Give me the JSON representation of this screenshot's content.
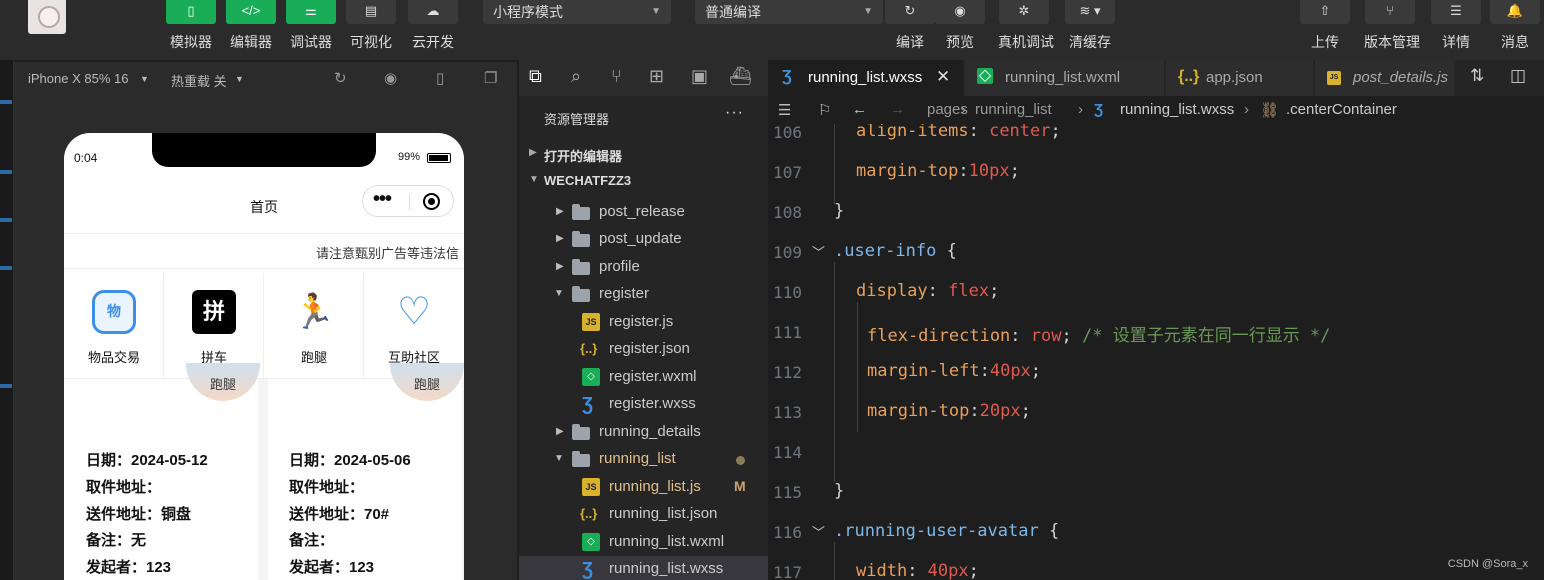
{
  "toolbar": {
    "left_buttons": [
      {
        "label": "模拟器",
        "icon": "phone-icon"
      },
      {
        "label": "编辑器",
        "icon": "code-icon"
      },
      {
        "label": "调试器",
        "icon": "sliders-icon"
      },
      {
        "label": "可视化",
        "icon": "layout-icon"
      },
      {
        "label": "云开发",
        "icon": "cloud-icon"
      }
    ],
    "mode_select": "小程序模式",
    "compile_select": "普通编译",
    "center_buttons": [
      {
        "label": "编译",
        "icon": "refresh-icon"
      },
      {
        "label": "预览",
        "icon": "eye-icon"
      },
      {
        "label": "真机调试",
        "icon": "bug-icon"
      },
      {
        "label": "清缓存",
        "icon": "layers-icon"
      }
    ],
    "right_buttons": [
      {
        "label": "上传",
        "icon": "upload-icon"
      },
      {
        "label": "版本管理",
        "icon": "branch-icon"
      },
      {
        "label": "详情",
        "icon": "menu-icon"
      },
      {
        "label": "消息",
        "icon": "bell-icon"
      }
    ]
  },
  "simulator": {
    "device": "iPhone X 85% 16",
    "hot_reload": "热重载 关",
    "status_time": "0:04",
    "battery": "99%",
    "nav_title": "首页",
    "notice": "请注意甄别广告等违法信",
    "categories": [
      {
        "label": "物品交易",
        "glyph": "物"
      },
      {
        "label": "拼车",
        "glyph": "拼"
      },
      {
        "label": "跑腿",
        "glyph": "🏃"
      },
      {
        "label": "互助社区",
        "glyph": "♡"
      }
    ],
    "cards": [
      {
        "tag": "跑腿",
        "date": "日期：2024-05-12",
        "pickup": "取件地址：",
        "delivery": "送件地址：铜盘",
        "note": "备注：无",
        "sender": "发起者：123"
      },
      {
        "tag": "跑腿",
        "date": "日期：2024-05-06",
        "pickup": "取件地址：",
        "delivery": "送件地址：70#",
        "note": "备注：",
        "sender": "发起者：123"
      }
    ]
  },
  "explorer": {
    "title": "资源管理器",
    "more": "···",
    "open_editors": "打开的编辑器",
    "project": "WECHATFZZ3",
    "items": [
      {
        "name": "post_release",
        "type": "folder"
      },
      {
        "name": "post_update",
        "type": "folder"
      },
      {
        "name": "profile",
        "type": "folder"
      },
      {
        "name": "register",
        "type": "folder-open"
      },
      {
        "name": "register.js",
        "type": "js"
      },
      {
        "name": "register.json",
        "type": "json"
      },
      {
        "name": "register.wxml",
        "type": "wxml"
      },
      {
        "name": "register.wxss",
        "type": "wxss"
      },
      {
        "name": "running_details",
        "type": "folder"
      },
      {
        "name": "running_list",
        "type": "folder-open"
      },
      {
        "name": "running_list.js",
        "type": "js",
        "badge": "M"
      },
      {
        "name": "running_list.json",
        "type": "json"
      },
      {
        "name": "running_list.wxml",
        "type": "wxml"
      },
      {
        "name": "running_list.wxss",
        "type": "wxss"
      }
    ]
  },
  "editor": {
    "tabs": [
      {
        "name": "running_list.wxss",
        "type": "wxss",
        "active": true
      },
      {
        "name": "running_list.wxml",
        "type": "wxml"
      },
      {
        "name": "app.json",
        "type": "json"
      },
      {
        "name": "post_details.js",
        "type": "js"
      }
    ],
    "breadcrumb": [
      "pages",
      "running_list",
      "running_list.wxss",
      ".centerContainer"
    ],
    "lines": [
      {
        "n": "106",
        "text": "align-items: center;"
      },
      {
        "n": "107",
        "text": "margin-top:10px;"
      },
      {
        "n": "108",
        "text": "}"
      },
      {
        "n": "109",
        "text": ".user-info {"
      },
      {
        "n": "110",
        "text": "display: flex;"
      },
      {
        "n": "111",
        "text": "flex-direction: row; /* 设置子元素在同一行显示 */"
      },
      {
        "n": "112",
        "text": "margin-left:40px;"
      },
      {
        "n": "113",
        "text": "margin-top:20px;"
      },
      {
        "n": "114",
        "text": ""
      },
      {
        "n": "115",
        "text": "}"
      },
      {
        "n": "116",
        "text": ".running-user-avatar {"
      },
      {
        "n": "117",
        "text": "width: 40px;"
      }
    ]
  },
  "watermark": "CSDN @Sora_x"
}
